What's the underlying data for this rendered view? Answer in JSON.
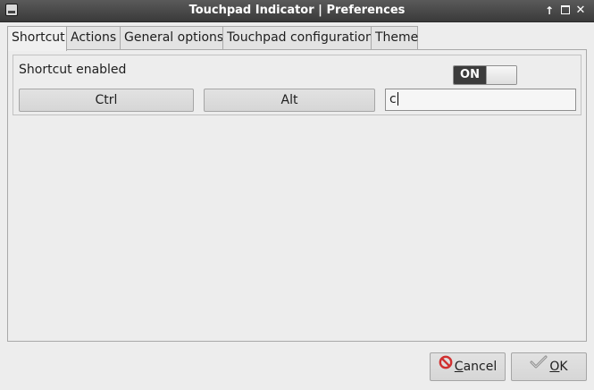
{
  "window": {
    "title": "Touchpad Indicator | Preferences"
  },
  "tabs": [
    {
      "label": "Shortcut",
      "active": true
    },
    {
      "label": "Actions",
      "active": false
    },
    {
      "label": "General options",
      "active": false
    },
    {
      "label": "Touchpad configuration",
      "active": false
    },
    {
      "label": "Theme",
      "active": false
    }
  ],
  "shortcut": {
    "enabled_label": "Shortcut enabled",
    "switch_state": "ON",
    "ctrl_label": "Ctrl",
    "alt_label": "Alt",
    "key_value": "c"
  },
  "actions": {
    "cancel_mnemonic": "C",
    "cancel_rest": "ancel",
    "ok_mnemonic": "O",
    "ok_rest": "K"
  },
  "icons": {
    "cancel": "cancel-icon",
    "ok": "checkmark-icon",
    "window": "window-icon"
  },
  "colors": {
    "titlebar": "#4a4a4a",
    "switch_on_bg": "#3c3c3c",
    "cancel_icon": "#d03030",
    "background": "#ededed"
  }
}
